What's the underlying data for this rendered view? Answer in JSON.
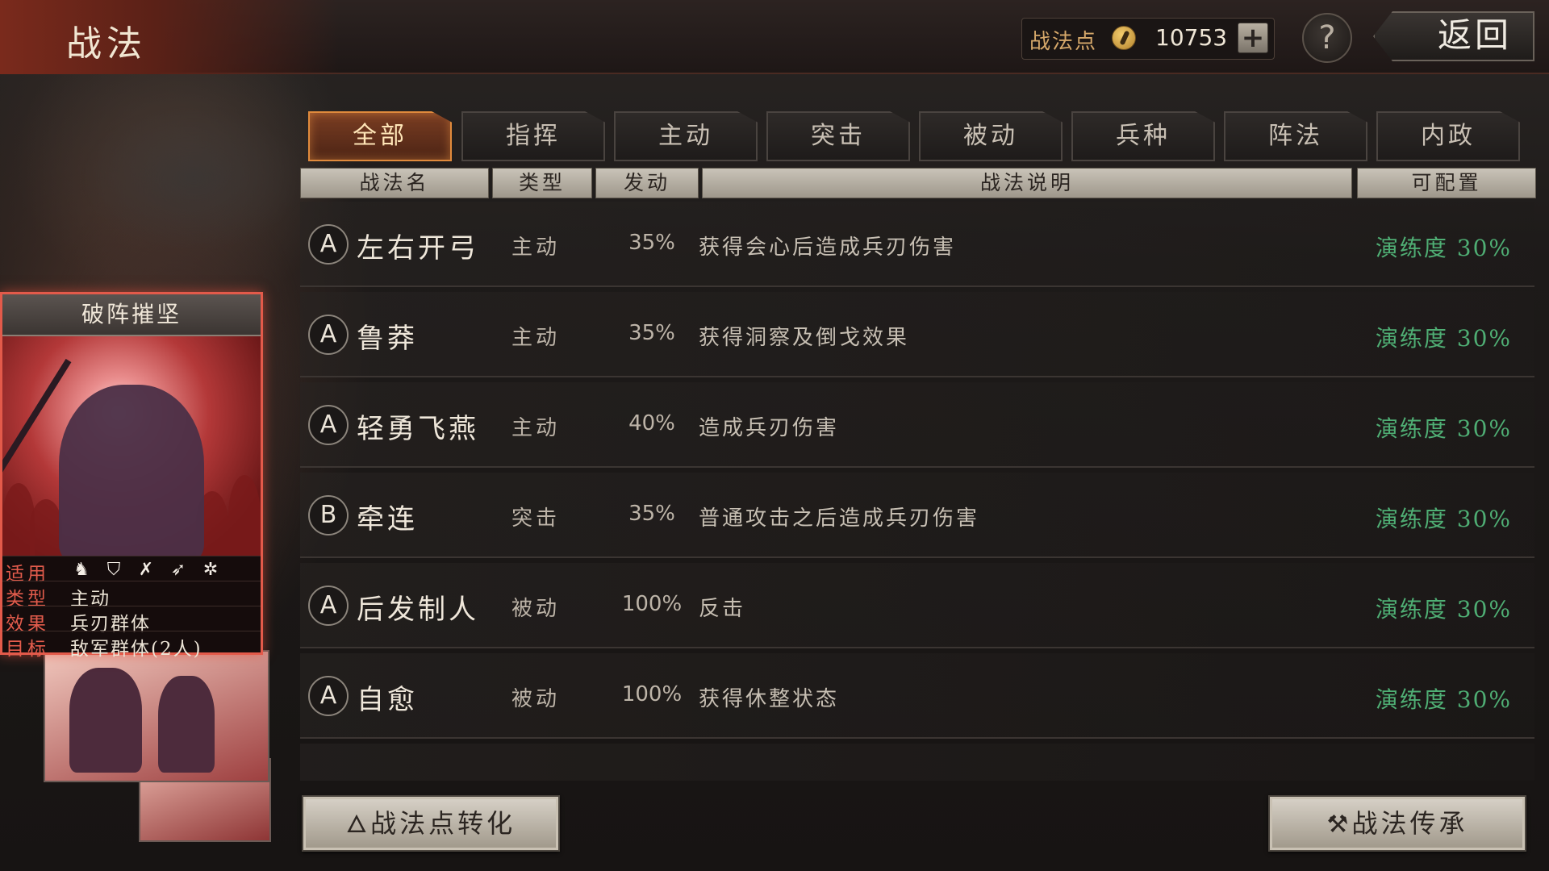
{
  "header": {
    "title": "战法",
    "points_label": "战法点",
    "points_value": "10753",
    "add_label": "+",
    "help_label": "?",
    "back_label": "返回"
  },
  "tabs": [
    "全部",
    "指挥",
    "主动",
    "突击",
    "被动",
    "兵种",
    "阵法",
    "内政"
  ],
  "active_tab": "全部",
  "columns": [
    "战法名",
    "类型",
    "发动",
    "战法说明",
    "可配置"
  ],
  "skills": [
    {
      "grade": "A",
      "name": "左右开弓",
      "type": "主动",
      "rate": "35%",
      "desc": "获得会心后造成兵刃伤害",
      "progress": "演练度 30%"
    },
    {
      "grade": "A",
      "name": "鲁莽",
      "type": "主动",
      "rate": "35%",
      "desc": "获得洞察及倒戈效果",
      "progress": "演练度 30%"
    },
    {
      "grade": "A",
      "name": "轻勇飞燕",
      "type": "主动",
      "rate": "40%",
      "desc": "造成兵刃伤害",
      "progress": "演练度 30%"
    },
    {
      "grade": "B",
      "name": "牵连",
      "type": "突击",
      "rate": "35%",
      "desc": "普通攻击之后造成兵刃伤害",
      "progress": "演练度 30%"
    },
    {
      "grade": "A",
      "name": "后发制人",
      "type": "被动",
      "rate": "100%",
      "desc": "反击",
      "progress": "演练度 30%"
    },
    {
      "grade": "A",
      "name": "自愈",
      "type": "被动",
      "rate": "100%",
      "desc": "获得休整状态",
      "progress": "演练度 30%"
    }
  ],
  "card": {
    "title": "破阵摧坚",
    "rows": [
      {
        "key": "适用",
        "value": ""
      },
      {
        "key": "类型",
        "value": "主动"
      },
      {
        "key": "效果",
        "value": "兵刃群体"
      },
      {
        "key": "目标",
        "value": "敌军群体(2人)"
      }
    ],
    "unit_icons": [
      "cavalry-icon",
      "shield-icon",
      "bow-icon",
      "spear-icon",
      "wheel-icon"
    ]
  },
  "buttons": {
    "convert_label": "战法点转化",
    "inherit_label": "战法传承"
  },
  "colors": {
    "accent": "#e08a3c",
    "progress_green": "#4fae74",
    "card_border": "#e35a4a"
  }
}
